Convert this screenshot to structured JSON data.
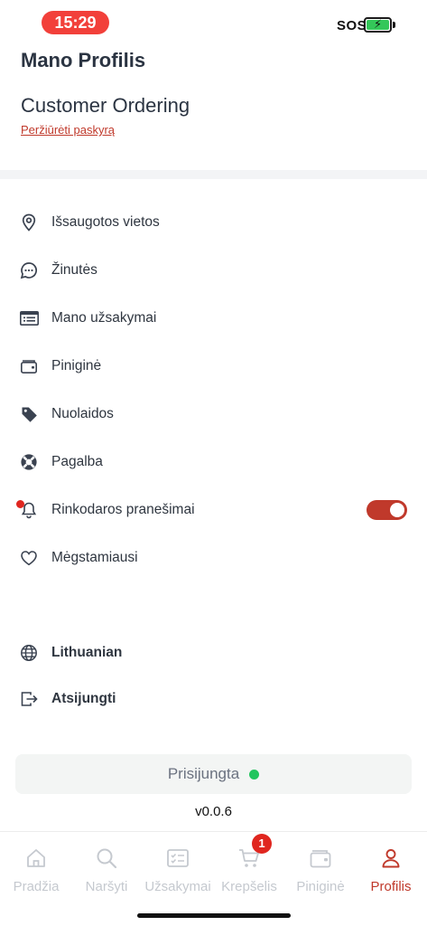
{
  "status_bar": {
    "time": "15:29",
    "sos": "SOS"
  },
  "header": {
    "title": "Mano Profilis",
    "account_name": "Customer Ordering",
    "view_account_link": "Peržiūrėti paskyrą"
  },
  "menu": {
    "items": [
      {
        "label": "Išsaugotos vietos",
        "icon": "location-pin-icon"
      },
      {
        "label": "Žinutės",
        "icon": "chat-bubble-icon"
      },
      {
        "label": "Mano užsakymai",
        "icon": "orders-list-icon"
      },
      {
        "label": "Piniginė",
        "icon": "wallet-icon"
      },
      {
        "label": "Nuolaidos",
        "icon": "tag-icon"
      },
      {
        "label": "Pagalba",
        "icon": "lifebuoy-icon"
      },
      {
        "label": "Rinkodaros pranešimai",
        "icon": "bell-icon",
        "toggle_on": true
      },
      {
        "label": "Mėgstamiausi",
        "icon": "heart-icon"
      }
    ],
    "language": {
      "label": "Lithuanian",
      "icon": "globe-icon"
    },
    "logout": {
      "label": "Atsijungti",
      "icon": "logout-icon"
    }
  },
  "connection": {
    "status_text": "Prisijungta",
    "status_color": "#22c55e"
  },
  "version": "v0.0.6",
  "tabbar": {
    "tabs": [
      {
        "label": "Pradžia",
        "icon": "home-icon"
      },
      {
        "label": "Naršyti",
        "icon": "search-icon"
      },
      {
        "label": "Užsakymai",
        "icon": "orders-icon"
      },
      {
        "label": "Krepšelis",
        "icon": "cart-icon",
        "badge": "1"
      },
      {
        "label": "Piniginė",
        "icon": "wallet-icon"
      },
      {
        "label": "Profilis",
        "icon": "user-icon",
        "active": true
      }
    ]
  },
  "colors": {
    "accent": "#c0392b",
    "text": "#2f3640",
    "inactive": "#c5c9cf"
  }
}
